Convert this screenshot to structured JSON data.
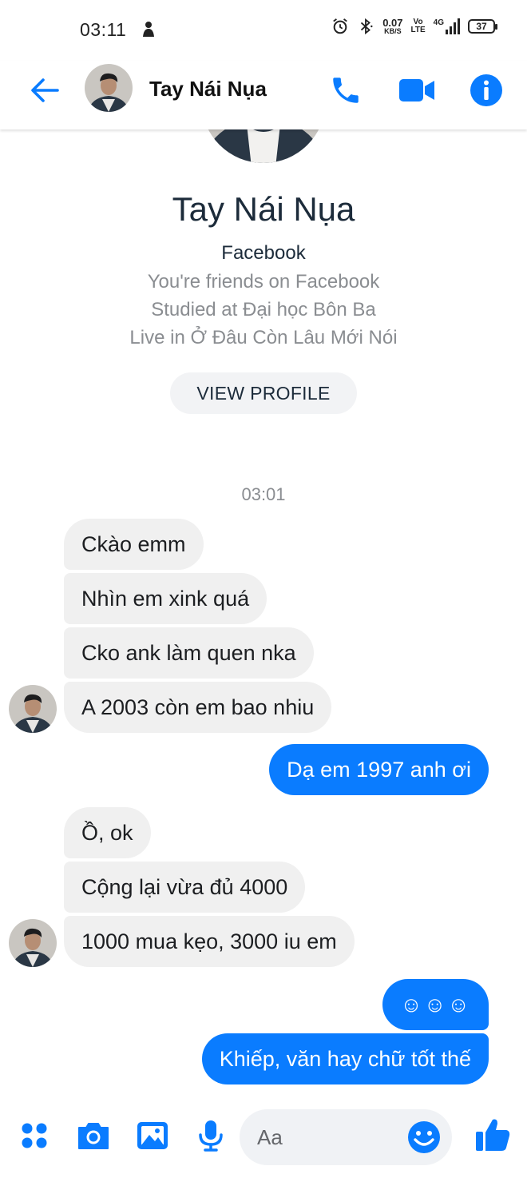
{
  "status_bar": {
    "time": "03:11",
    "net_speed_value": "0.07",
    "net_speed_unit": "KB/S",
    "volte_top": "Vo",
    "volte_bottom": "LTE",
    "network": "4G",
    "battery": "37"
  },
  "header": {
    "contact_name": "Tay Nái Nụa",
    "icons": [
      "back-arrow-icon",
      "phone-icon",
      "video-camera-icon",
      "info-icon"
    ]
  },
  "profile": {
    "name": "Tay Nái Nụa",
    "source": "Facebook",
    "details": [
      "You're friends on Facebook",
      "Studied at Đại học Bôn Ba",
      "Live in Ở Đâu Còn Lâu Mới Nói"
    ],
    "view_profile_label": "VIEW PROFILE"
  },
  "conversation": {
    "timestamp": "03:01",
    "messages": [
      {
        "sender": "them",
        "text": "Ckào emm"
      },
      {
        "sender": "them",
        "text": "Nhìn em xink quá"
      },
      {
        "sender": "them",
        "text": "Cko ank làm quen nka"
      },
      {
        "sender": "them",
        "text": "A 2003 còn em bao nhiu"
      },
      {
        "sender": "me",
        "text": "Dạ em 1997 anh ơi"
      },
      {
        "sender": "them",
        "text": "Ồ, ok"
      },
      {
        "sender": "them",
        "text": "Cộng lại vừa đủ 4000"
      },
      {
        "sender": "them",
        "text": "1000 mua kẹo, 3000 iu em"
      },
      {
        "sender": "me",
        "text": "☺☺☺"
      },
      {
        "sender": "me",
        "text": "Khiếp, văn hay chữ tốt thế"
      }
    ]
  },
  "composer": {
    "placeholder": "Aa",
    "value": "",
    "icons": [
      "apps-icon",
      "camera-icon",
      "gallery-icon",
      "microphone-icon",
      "emoji-icon",
      "thumbs-up-icon"
    ]
  },
  "colors": {
    "accent": "#0a7cff",
    "incoming_bubble": "#f0f0f0",
    "muted_text": "#8a8d91",
    "name_text": "#1c2b3a"
  }
}
